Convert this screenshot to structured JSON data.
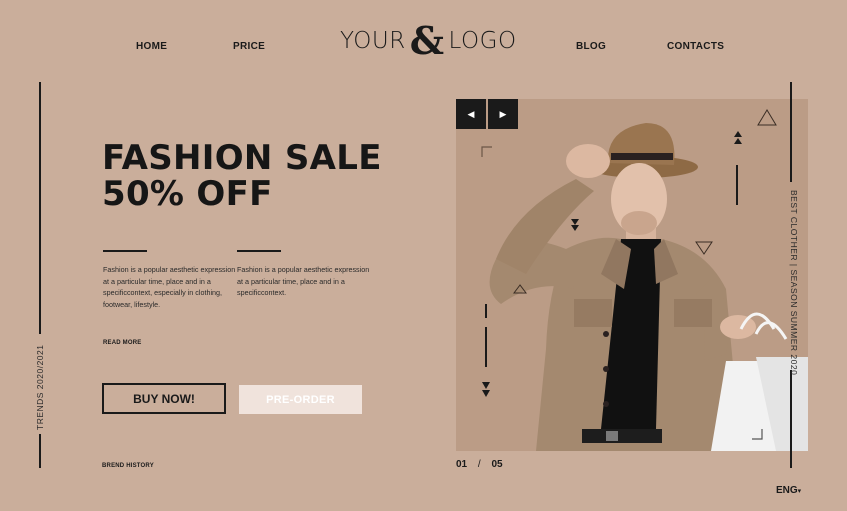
{
  "nav": {
    "home": "HOME",
    "price": "PRICE",
    "blog": "BLOG",
    "contacts": "CONTACTS"
  },
  "logo": {
    "left": "YOUR",
    "amp": "&",
    "right": "LOGO"
  },
  "sidebar": {
    "trends": "TRENDS 2020/2021"
  },
  "hero": {
    "line1": "FASHION SALE",
    "line2": "50% OFF",
    "para1": "Fashion is a popular aesthetic expression at a particular time, place and in a specificcontext, especially in clothing, footwear, lifestyle.",
    "para2": "Fashion is a popular aesthetic expression at a particular time, place and in a specificcontext.",
    "read_more": "READ MORE",
    "buy_now": "BUY NOW!",
    "pre_order": "PRE-ORDER",
    "brand_history": "BREND HISTORY"
  },
  "slider": {
    "prev_icon": "arrow-left-icon",
    "next_icon": "arrow-right-icon",
    "current": "01",
    "separator": "/",
    "total": "05",
    "side_text": "BEST CLOTHER | SEASON SUMMER 2020"
  },
  "lang": {
    "label": "ENG",
    "caret": "▾"
  },
  "colors": {
    "background": "#caae9b",
    "ink": "#1a1a1a",
    "button_light": "#f0e3dc",
    "jacket": "#a4896f",
    "hat": "#8e6a45"
  }
}
